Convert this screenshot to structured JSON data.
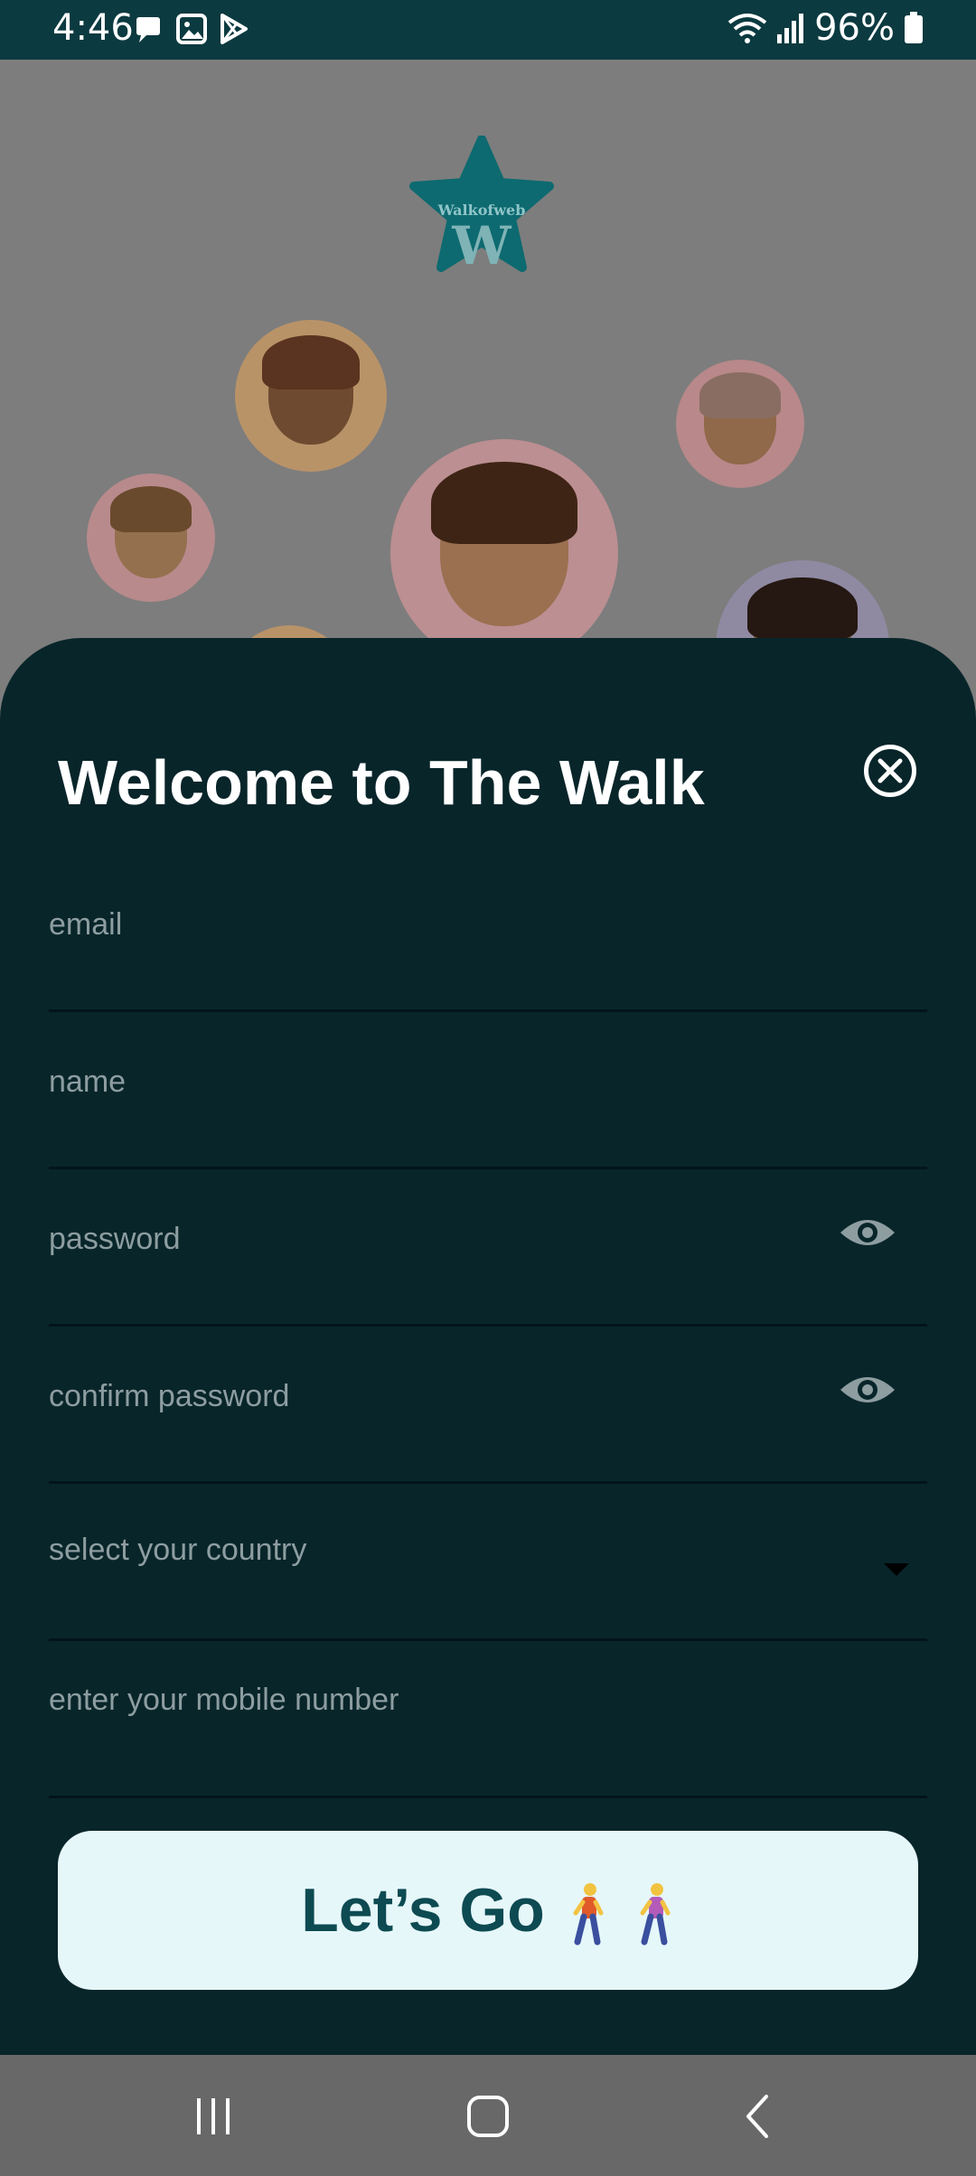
{
  "status_bar": {
    "time": "4:46",
    "battery": "96%",
    "left_icons": [
      "message-icon",
      "image-icon",
      "play-store-icon"
    ],
    "right_icons": [
      "wifi-icon",
      "signal-icon",
      "battery-icon"
    ]
  },
  "background": {
    "logo_text": "Walkofweb",
    "logo_letter": "W",
    "avatars": [
      "avatar-girl-beret",
      "avatar-girl-glasses",
      "avatar-boy-glasses",
      "avatar-girl-cowboy-hat",
      "avatar-boy-dark-hair"
    ]
  },
  "sheet": {
    "title": "Welcome to The Walk",
    "fields": {
      "email": "email",
      "name": "name",
      "password": "password",
      "confirm_password": "confirm password",
      "country": "select your country",
      "mobile": "enter your mobile number"
    },
    "submit_label": "Let’s Go"
  },
  "colors": {
    "status_bar": "#0b3a40",
    "sheet_bg": "#08252a",
    "button_bg": "#e6f7fa",
    "button_text": "#0d4a52",
    "placeholder": "#8d9da0",
    "logo": "#0d6a70"
  },
  "nav_bar": {
    "items": [
      "recent-apps-icon",
      "home-icon",
      "back-icon"
    ]
  }
}
